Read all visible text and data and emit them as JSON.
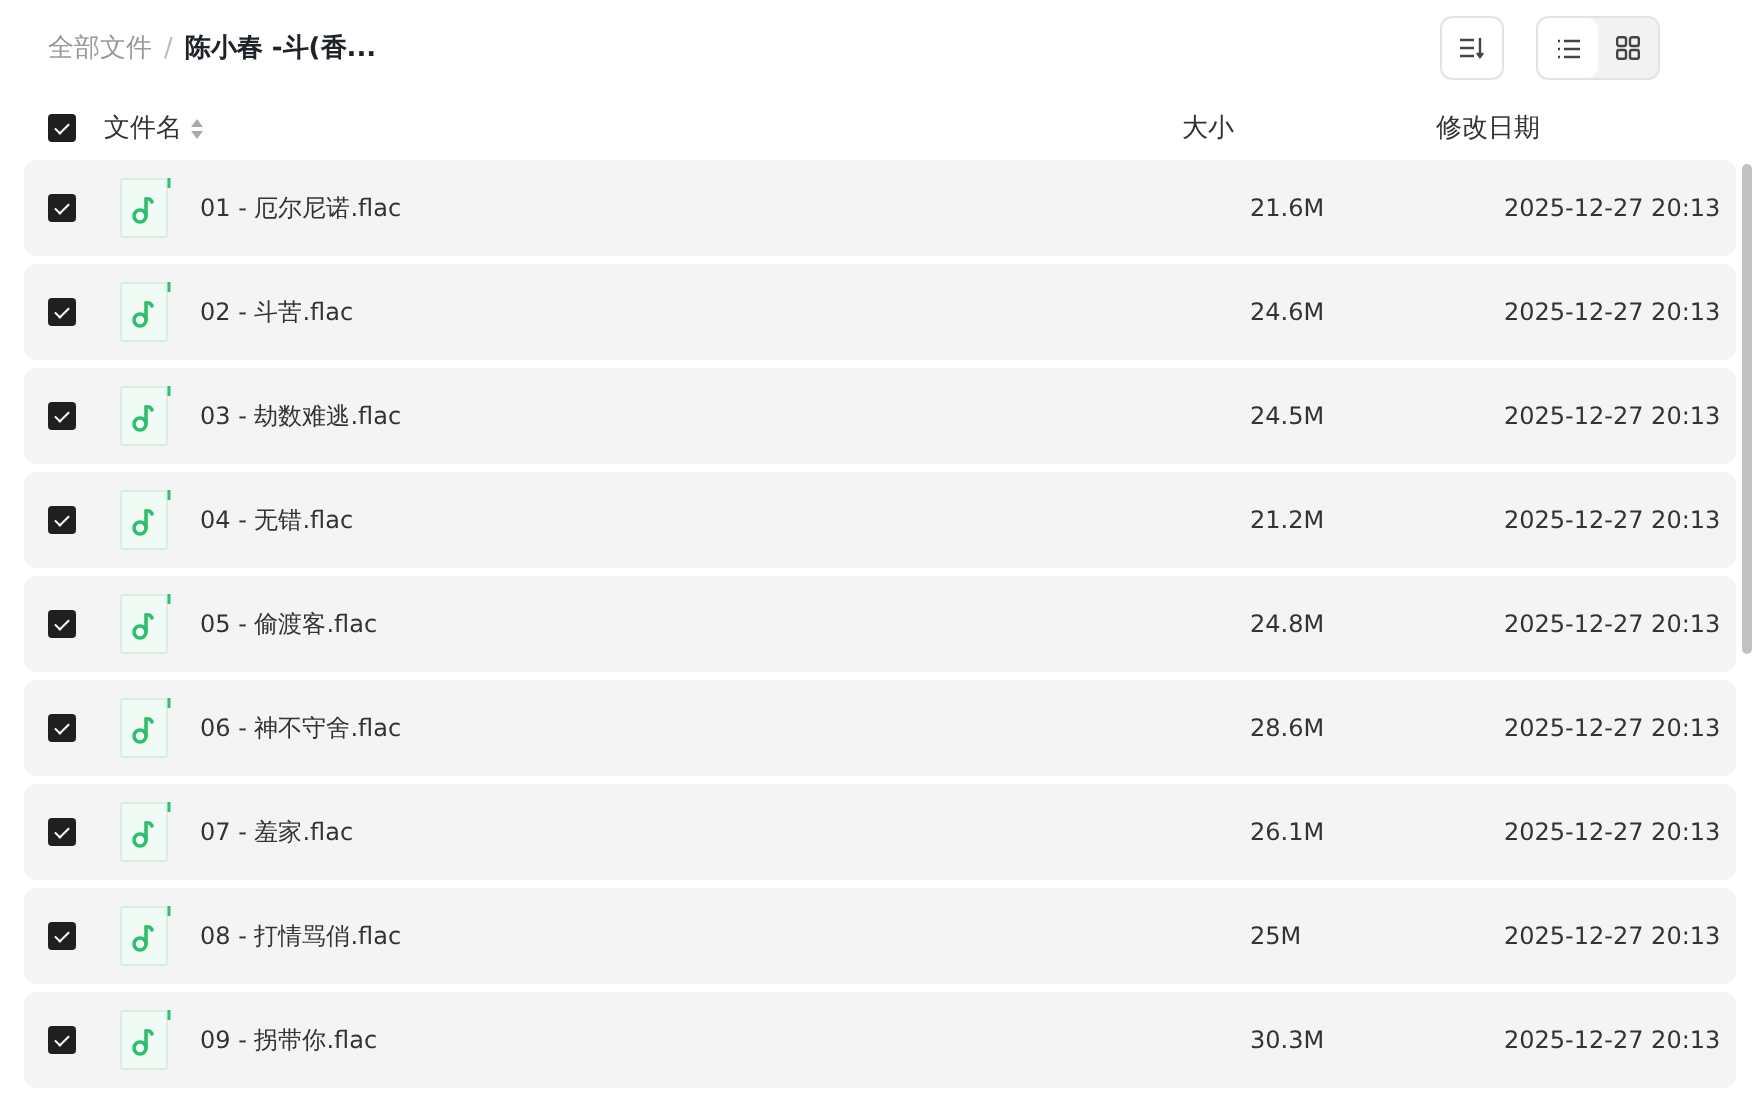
{
  "breadcrumb": [
    {
      "label": "全部文件",
      "current": false
    },
    {
      "label": "陈小春 -斗(香...",
      "current": true
    }
  ],
  "breadcrumb_separator": "/",
  "view_modes": [
    {
      "kind": "list",
      "selected": true
    },
    {
      "kind": "grid",
      "selected": false
    }
  ],
  "columns": {
    "all_checked": true,
    "name": "文件名",
    "size": "大小",
    "modified": "修改日期"
  },
  "rows": [
    {
      "name": "01 - 厄尔尼诺.flac",
      "size": "21.6M",
      "modified": "2025-12-27 20:13",
      "checked": true
    },
    {
      "name": "02 - 斗苦.flac",
      "size": "24.6M",
      "modified": "2025-12-27 20:13",
      "checked": true
    },
    {
      "name": "03 - 劫数难逃.flac",
      "size": "24.5M",
      "modified": "2025-12-27 20:13",
      "checked": true
    },
    {
      "name": "04 - 无错.flac",
      "size": "21.2M",
      "modified": "2025-12-27 20:13",
      "checked": true
    },
    {
      "name": "05 - 偷渡客.flac",
      "size": "24.8M",
      "modified": "2025-12-27 20:13",
      "checked": true
    },
    {
      "name": "06 - 神不守舍.flac",
      "size": "28.6M",
      "modified": "2025-12-27 20:13",
      "checked": true
    },
    {
      "name": "07 - 羞家.flac",
      "size": "26.1M",
      "modified": "2025-12-27 20:13",
      "checked": true
    },
    {
      "name": "08 - 打情骂俏.flac",
      "size": "25M",
      "modified": "2025-12-27 20:13",
      "checked": true
    },
    {
      "name": "09 - 拐带你.flac",
      "size": "30.3M",
      "modified": "2025-12-27 20:13",
      "checked": true
    }
  ]
}
